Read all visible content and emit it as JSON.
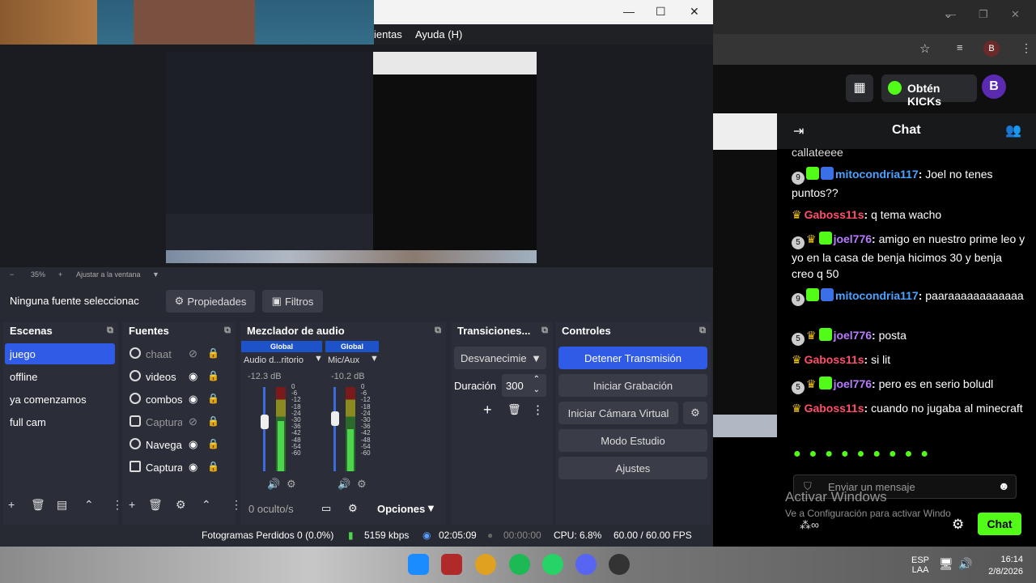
{
  "obs": {
    "menu": {
      "tools": "ientas",
      "help": "Ayuda (H)"
    },
    "zoom": {
      "level": "35%",
      "fit": "Ajustar a la ventana"
    },
    "source_bar": {
      "selected": "Ninguna fuente seleccionac",
      "properties": "Propiedades",
      "filters": "Filtros"
    },
    "scenes": {
      "title": "Escenas",
      "items": [
        "juego",
        "offline",
        "ya comenzamos",
        "full cam"
      ]
    },
    "sources": {
      "title": "Fuentes",
      "items": [
        "chaat",
        "videos",
        "combos",
        "Captura",
        "Navega",
        "Captura"
      ]
    },
    "mixer": {
      "title": "Mezclador de audio",
      "ch1": {
        "tag": "Global",
        "name": "Audio d...ritorio",
        "db": "-12.3 dB"
      },
      "ch2": {
        "tag": "Global",
        "name": "Mic/Aux",
        "db": "-10.2 dB"
      },
      "scale": [
        "0",
        "-6",
        "-12",
        "-18",
        "-24",
        "-30",
        "-36",
        "-42",
        "-48",
        "-54",
        "-60"
      ],
      "hidden": "0 oculto/s",
      "options": "Opciones"
    },
    "transitions": {
      "title": "Transiciones...",
      "type": "Desvanecimie",
      "duration_label": "Duración",
      "duration": "300"
    },
    "controls": {
      "title": "Controles",
      "stop_stream": "Detener Transmisión",
      "start_record": "Iniciar Grabación",
      "start_vcam": "Iniciar Cámara Virtual",
      "studio": "Modo Estudio",
      "settings": "Ajustes"
    },
    "status": {
      "dropped": "Fotogramas Perdidos 0 (0.0%)",
      "bitrate": "5159 kbps",
      "live_time": "02:05:09",
      "rec_time": "00:00:00",
      "cpu": "CPU: 6.8%",
      "fps": "60.00 / 60.00 FPS"
    }
  },
  "kick": {
    "get_kicks": "Obtén KICKs",
    "chat_title": "Chat",
    "messages": [
      {
        "user": "",
        "text": "callateeee"
      },
      {
        "badge": "9",
        "user": "mitocondria117",
        "color": "blue",
        "text": "Joel no tenes puntos??"
      },
      {
        "badge": "",
        "user": "Gaboss11s",
        "color": "red",
        "text": "q tema wacho"
      },
      {
        "badge": "5",
        "user": "joel776",
        "color": "purple",
        "text": "amigo en nuestro prime leo y yo en la casa de benja hicimos 30 y benja creo q 50"
      },
      {
        "badge": "9",
        "user": "mitocondria117",
        "color": "blue",
        "text": "paaraaaaaaaaaaaa"
      },
      {
        "badge": "5",
        "user": "joel776",
        "color": "purple",
        "text": "posta"
      },
      {
        "badge": "",
        "user": "Gaboss11s",
        "color": "red",
        "text": "si lit"
      },
      {
        "badge": "5",
        "user": "joel776",
        "color": "purple",
        "text": "pero es en serio boludl"
      },
      {
        "badge": "",
        "user": "Gaboss11s",
        "color": "red",
        "text": "cuando no jugaba al minecraft"
      }
    ],
    "input_placeholder": "Enviar un mensaje",
    "send": "Chat",
    "watermark1": "Activar Windows",
    "watermark2": "Ve a Configuración para activar Windo"
  },
  "taskbar": {
    "lang1": "ESP",
    "lang2": "LAA",
    "time": "16:14",
    "date": "2/8/2026"
  },
  "chrome": {
    "avatar": "B"
  }
}
